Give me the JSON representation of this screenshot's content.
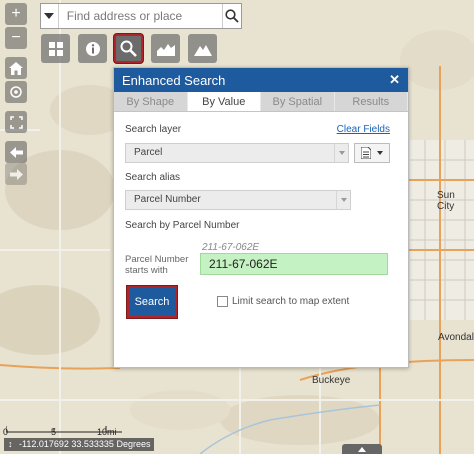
{
  "map": {
    "places": [
      "Sun City",
      "Buckeye",
      "Avondale"
    ],
    "coordinates": "-112.017692 33.533335 Degrees",
    "scale_labels": [
      "0",
      "5",
      "10mi"
    ]
  },
  "left_toolbar": {
    "zoom_in": "+",
    "zoom_out": "−"
  },
  "search": {
    "placeholder": "Find address or place"
  },
  "panel": {
    "title": "Enhanced Search",
    "close": "✕",
    "tabs": [
      "By Shape",
      "By Value",
      "By Spatial",
      "Results"
    ],
    "active_tab": "By Value",
    "search_layer_label": "Search layer",
    "clear_fields": "Clear Fields",
    "search_layer_value": "Parcel",
    "search_alias_label": "Search alias",
    "search_alias_value": "Parcel Number",
    "search_by_label": "Search by Parcel Number",
    "example": "211-67-062E",
    "parcel_label": "Parcel Number starts with",
    "parcel_value": "211-67-062E",
    "search_button": "Search",
    "limit_label": "Limit search to map extent"
  },
  "colors": {
    "header_blue": "#1e5b9e",
    "highlight_red": "#b0252c",
    "input_green": "#c5f2c2"
  }
}
